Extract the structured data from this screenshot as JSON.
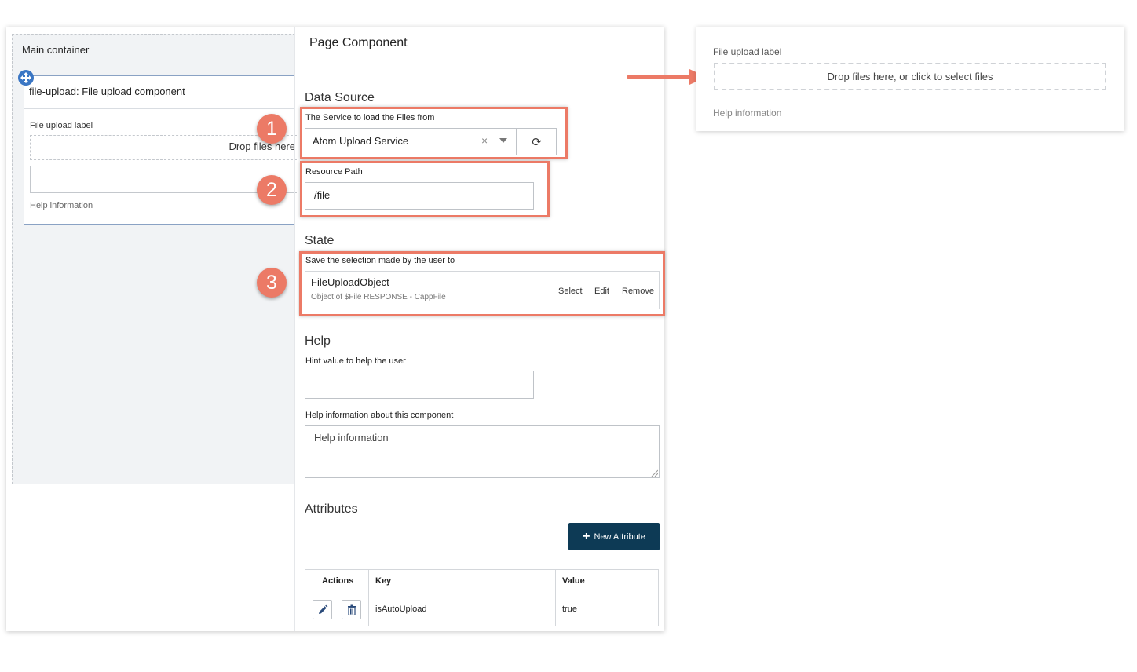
{
  "canvas": {
    "container_title": "Main container",
    "component_title": "file-upload: File upload component",
    "upload_label": "File upload label",
    "drop_text": "Drop files here",
    "help_text": "Help information"
  },
  "panel": {
    "title": "Page Component",
    "data_source": {
      "heading": "Data Source",
      "service_label": "The Service to load the Files from",
      "service_value": "Atom Upload Service",
      "clear_glyph": "×",
      "refresh_glyph": "⟳",
      "resource_label": "Resource Path",
      "resource_value": "/file"
    },
    "state": {
      "heading": "State",
      "save_label": "Save the selection made by the user to",
      "object_name": "FileUploadObject",
      "object_desc": "Object of $File RESPONSE - CappFile",
      "select_label": "Select",
      "edit_label": "Edit",
      "remove_label": "Remove"
    },
    "help": {
      "heading": "Help",
      "hint_label": "Hint value to help the user",
      "hint_value": "",
      "info_label": "Help information about this component",
      "info_value": "Help information"
    },
    "attributes": {
      "heading": "Attributes",
      "new_button_label": "New Attribute",
      "columns": [
        "Actions",
        "Key",
        "Value"
      ],
      "rows": [
        {
          "key": "isAutoUpload",
          "value": "true"
        }
      ]
    }
  },
  "annotations": {
    "badges": [
      "1",
      "2",
      "3"
    ],
    "color": "#ec7a66"
  },
  "preview": {
    "upload_label": "File upload label",
    "drop_text": "Drop files here, or click to select files",
    "help_text": "Help information"
  },
  "colors": {
    "accent": "#0d3a55",
    "highlight": "#ec7a66",
    "handle": "#3a76c4"
  }
}
